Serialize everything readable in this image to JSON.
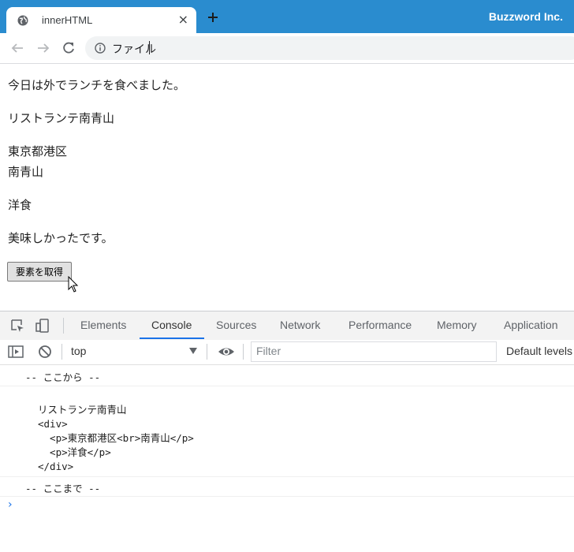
{
  "browser": {
    "tab_title": "innerHTML",
    "tab_close": "×",
    "brand": "Buzzword Inc.",
    "url": "ファイル"
  },
  "page": {
    "p1": "今日は外でランチを食べました。",
    "p2": "リストランテ南青山",
    "p3_line1": "東京都港区",
    "p3_line2": "南青山",
    "p4": "洋食",
    "p5": "美味しかったです。",
    "button": "要素を取得"
  },
  "devtools": {
    "tabs": [
      "Elements",
      "Console",
      "Sources",
      "Network",
      "Performance",
      "Memory",
      "Application"
    ],
    "active_tab": "Console",
    "context": "top",
    "filter_placeholder": "Filter",
    "levels": "Default levels",
    "log_start": "-- ここから --",
    "log_body": "リストランテ南青山\n<div>\n  <p>東京都港区<br>南青山</p>\n  <p>洋食</p>\n</div>",
    "log_end": "-- ここまで --",
    "prompt": "›"
  },
  "colors": {
    "titlebar": "#2a8ccf",
    "accent": "#1a73e8"
  }
}
